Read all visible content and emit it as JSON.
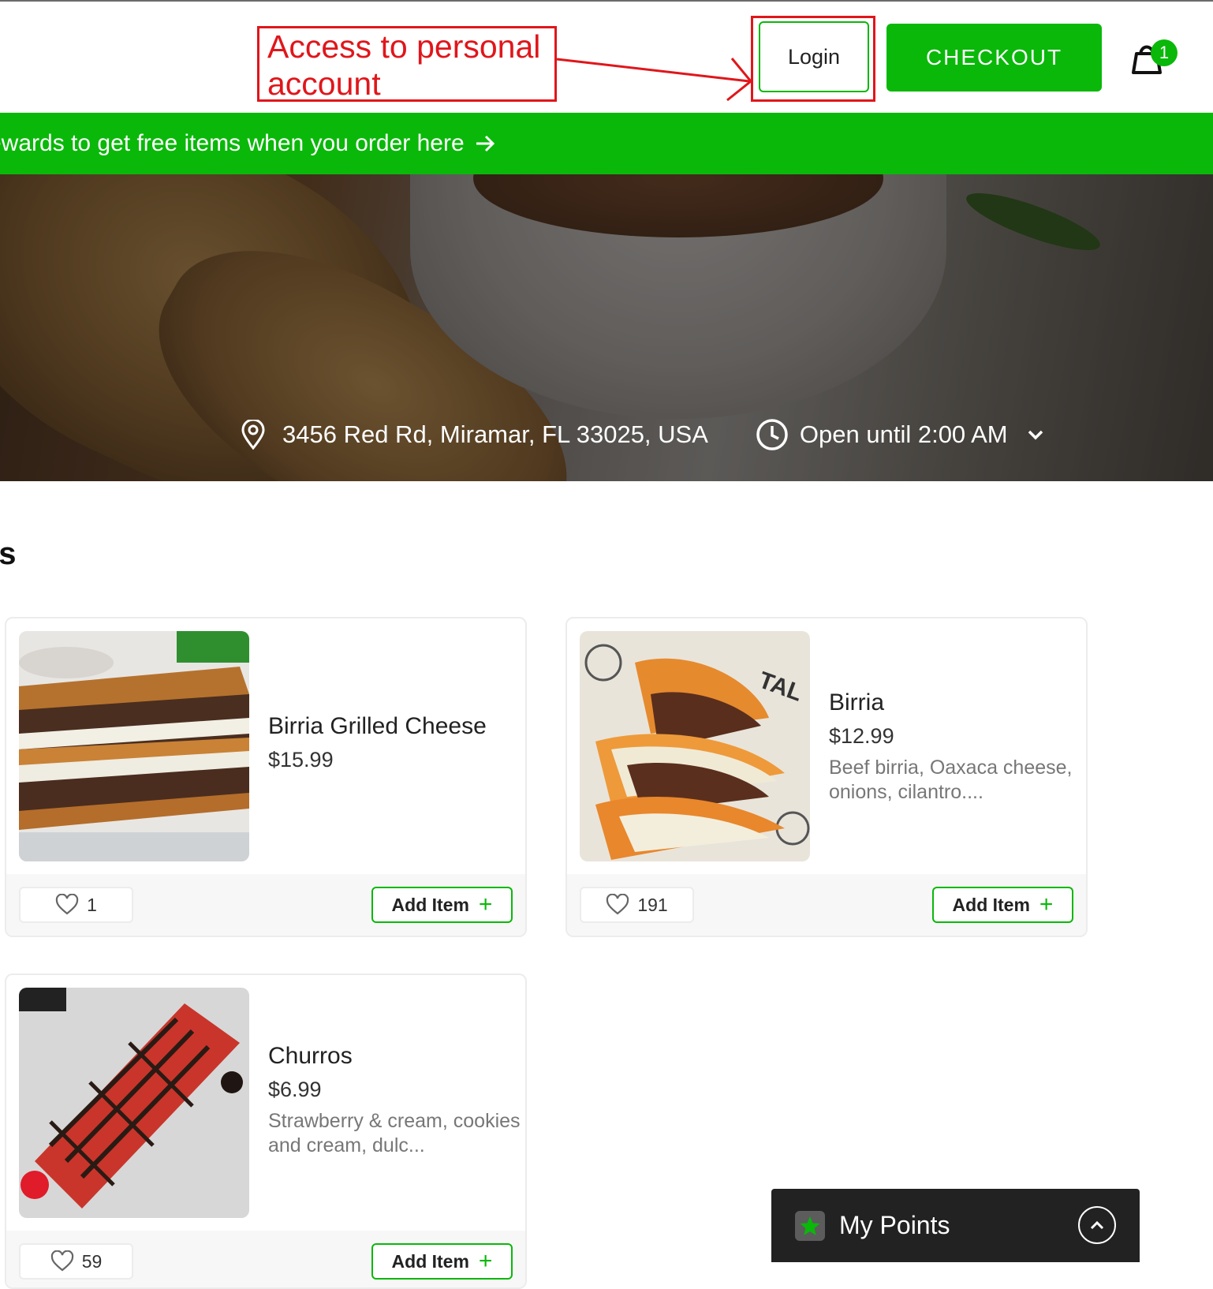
{
  "annotation": {
    "text": "Access to personal account",
    "color": "#e0161b"
  },
  "header": {
    "login_label": "Login",
    "checkout_label": "CHECKOUT",
    "cart_count": "1",
    "accent_color": "#0ab80a"
  },
  "rewards_banner": {
    "text": "ewards to get free items when you order here",
    "arrow_icon": "arrow-right-icon"
  },
  "store": {
    "address": "3456 Red Rd, Miramar, FL 33025, USA",
    "hours": "Open until 2:00 AM"
  },
  "section": {
    "title": "ks"
  },
  "menu_items": [
    {
      "name": "Birria Grilled Cheese",
      "price": "$15.99",
      "description": "",
      "likes": "1",
      "add_label": "Add Item"
    },
    {
      "name": "Birria",
      "price": "$12.99",
      "description": "Beef birria, Oaxaca cheese, onions, cilantro....",
      "likes": "191",
      "add_label": "Add Item"
    },
    {
      "name": "Churros",
      "price": "$6.99",
      "description": "Strawberry & cream, cookies and cream, dulc...",
      "likes": "59",
      "add_label": "Add Item"
    }
  ],
  "points_widget": {
    "label": "My Points"
  }
}
